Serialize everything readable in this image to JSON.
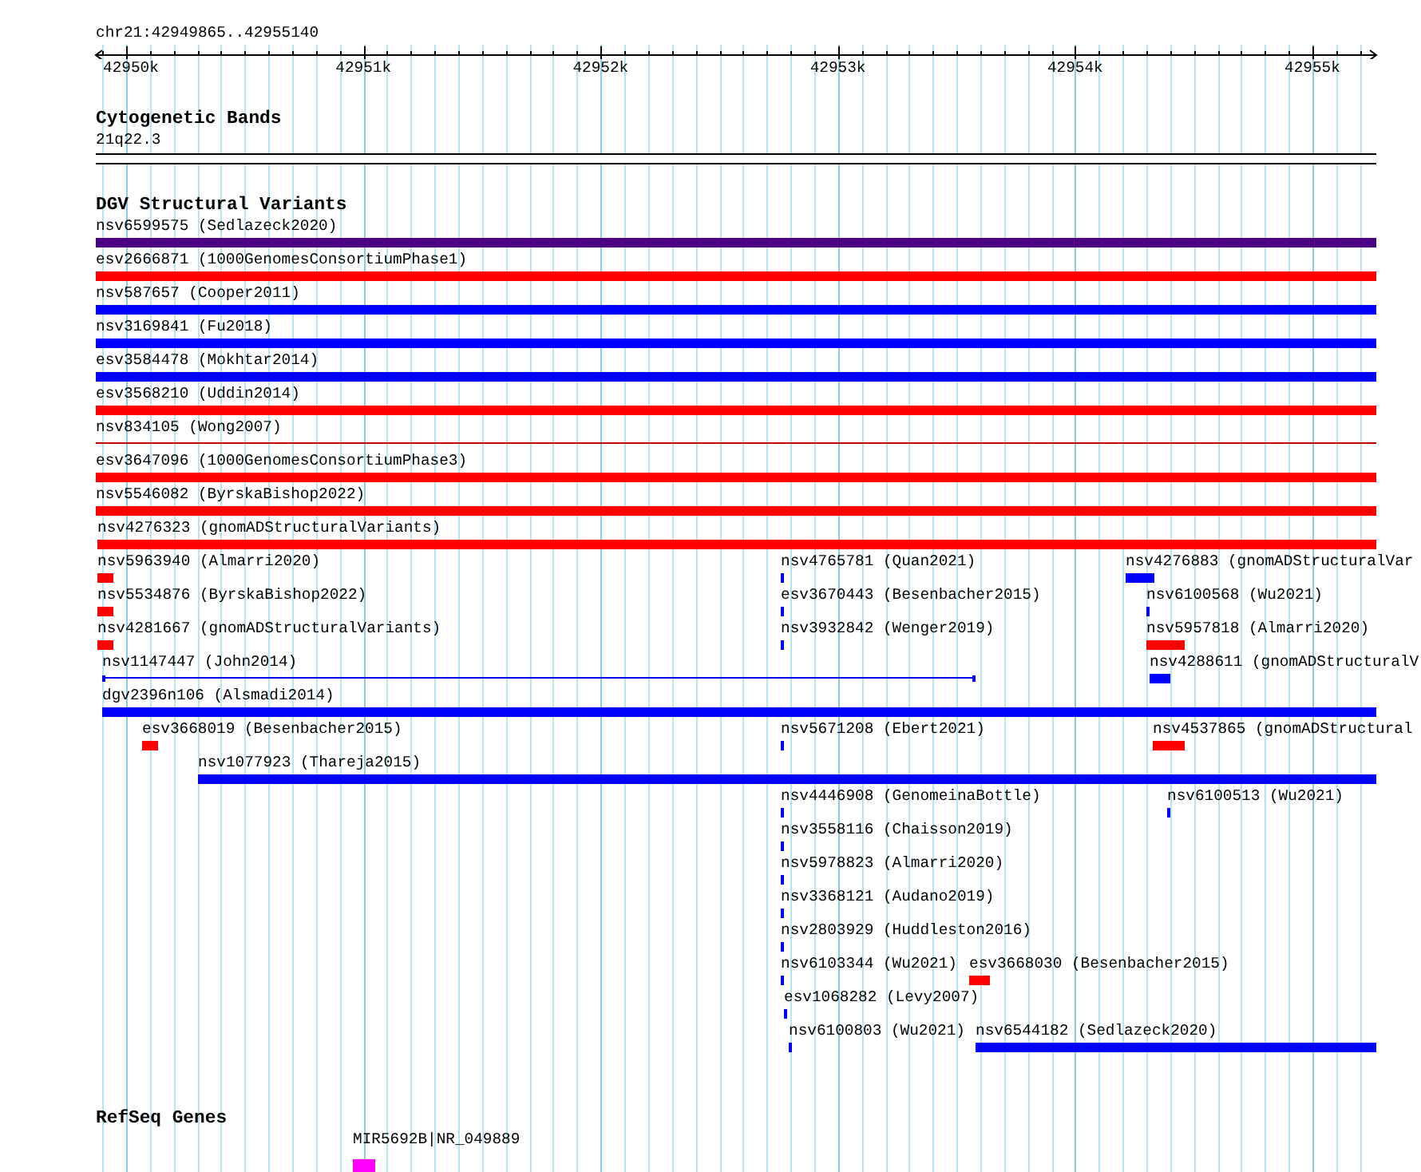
{
  "ruler": {
    "location": "chr21:42949865..42955140",
    "ticks": [
      {
        "label": "42950k"
      },
      {
        "label": "42951k"
      },
      {
        "label": "42952k"
      },
      {
        "label": "42953k"
      },
      {
        "label": "42954k"
      },
      {
        "label": "42955k"
      }
    ]
  },
  "tracks": [
    {
      "kind": "cytoband",
      "title": "Cytogenetic Bands",
      "bands": [
        {
          "name": "21q22.3"
        }
      ]
    },
    {
      "kind": "features",
      "title": "DGV Structural Variants",
      "lanes": [
        {
          "features": [
            {
              "kind": "bar",
              "label": "nsv6599575 (Sedlazeck2020)",
              "color": "#4b0082"
            }
          ]
        },
        {
          "features": [
            {
              "kind": "bar",
              "label": "esv2666871 (1000GenomesConsortiumPhase1)",
              "color": "#ff0000"
            }
          ]
        },
        {
          "features": [
            {
              "kind": "bar",
              "label": "nsv587657 (Cooper2011)",
              "color": "#0000ff"
            }
          ]
        },
        {
          "features": [
            {
              "kind": "bar",
              "label": "nsv3169841 (Fu2018)",
              "color": "#0000ff"
            }
          ]
        },
        {
          "features": [
            {
              "kind": "bar",
              "label": "esv3584478 (Mokhtar2014)",
              "color": "#0000ff"
            }
          ]
        },
        {
          "features": [
            {
              "kind": "bar",
              "label": "esv3568210 (Uddin2014)",
              "color": "#ff0000"
            }
          ]
        },
        {
          "features": [
            {
              "kind": "line",
              "label": "nsv834105 (Wong2007)",
              "color": "#c00000"
            }
          ]
        },
        {
          "features": [
            {
              "kind": "bar",
              "label": "esv3647096 (1000GenomesConsortiumPhase3)",
              "color": "#ff0000"
            }
          ]
        },
        {
          "features": [
            {
              "kind": "bar",
              "label": "nsv5546082 (ByrskaBishop2022)",
              "color": "#ff0000"
            }
          ]
        },
        {
          "features": [
            {
              "kind": "bar",
              "label": "nsv4276323 (gnomADStructuralVariants)",
              "color": "#ff0000"
            }
          ]
        },
        {
          "features": [
            {
              "kind": "bar",
              "label": "nsv5963940 (Almarri2020)",
              "color": "#ff0000"
            },
            {
              "kind": "bar",
              "label": "nsv4765781 (Quan2021)",
              "color": "#0000ff"
            },
            {
              "kind": "bar",
              "label": "nsv4276883 (gnomADStructuralVar",
              "color": "#0000ff"
            }
          ]
        },
        {
          "features": [
            {
              "kind": "bar",
              "label": "nsv5534876 (ByrskaBishop2022)",
              "color": "#ff0000"
            },
            {
              "kind": "bar",
              "label": "esv3670443 (Besenbacher2015)",
              "color": "#0000ff"
            },
            {
              "kind": "bar",
              "label": "nsv6100568 (Wu2021)",
              "color": "#0000ff"
            }
          ]
        },
        {
          "features": [
            {
              "kind": "bar",
              "label": "nsv4281667 (gnomADStructuralVariants)",
              "color": "#ff0000"
            },
            {
              "kind": "bar",
              "label": "nsv3932842 (Wenger2019)",
              "color": "#0000ff"
            },
            {
              "kind": "bar",
              "label": "nsv5957818 (Almarri2020)",
              "color": "#ff0000"
            }
          ]
        },
        {
          "features": [
            {
              "kind": "line",
              "label": "nsv1147447 (John2014)",
              "color": "#0000ff"
            },
            {
              "kind": "bar",
              "label": "nsv4288611 (gnomADStructuralV",
              "color": "#0000ff"
            }
          ]
        },
        {
          "features": [
            {
              "kind": "bar",
              "label": "dgv2396n106 (Alsmadi2014)",
              "color": "#0000ff"
            }
          ]
        },
        {
          "features": [
            {
              "kind": "bar",
              "label": "esv3668019 (Besenbacher2015)",
              "color": "#ff0000"
            },
            {
              "kind": "bar",
              "label": "nsv5671208 (Ebert2021)",
              "color": "#0000ff"
            },
            {
              "kind": "bar",
              "label": "nsv4537865 (gnomADStructural",
              "color": "#ff0000"
            }
          ]
        },
        {
          "features": [
            {
              "kind": "bar",
              "label": "nsv1077923 (Thareja2015)",
              "color": "#0000ff"
            }
          ]
        },
        {
          "features": [
            {
              "kind": "bar",
              "label": "nsv4446908 (GenomeinaBottle)",
              "color": "#0000ff"
            },
            {
              "kind": "bar",
              "label": "nsv6100513 (Wu2021)",
              "color": "#0000ff"
            }
          ]
        },
        {
          "features": [
            {
              "kind": "bar",
              "label": "nsv3558116 (Chaisson2019)",
              "color": "#0000ff"
            }
          ]
        },
        {
          "features": [
            {
              "kind": "bar",
              "label": "nsv5978823 (Almarri2020)",
              "color": "#0000ff"
            }
          ]
        },
        {
          "features": [
            {
              "kind": "bar",
              "label": "nsv3368121 (Audano2019)",
              "color": "#0000ff"
            }
          ]
        },
        {
          "features": [
            {
              "kind": "bar",
              "label": "nsv2803929 (Huddleston2016)",
              "color": "#0000ff"
            }
          ]
        },
        {
          "features": [
            {
              "kind": "bar",
              "label": "nsv6103344 (Wu2021)",
              "color": "#0000ff"
            },
            {
              "kind": "bar",
              "label": "esv3668030 (Besenbacher2015)",
              "color": "#ff0000"
            }
          ]
        },
        {
          "features": [
            {
              "kind": "bar",
              "label": "esv1068282 (Levy2007)",
              "color": "#0000ff"
            }
          ]
        },
        {
          "features": [
            {
              "kind": "bar",
              "label": "nsv6100803 (Wu2021)",
              "color": "#0000ff"
            },
            {
              "kind": "bar",
              "label": "nsv6544182 (Sedlazeck2020)",
              "color": "#0000ff"
            }
          ]
        }
      ]
    },
    {
      "kind": "genes",
      "title": "RefSeq Genes",
      "lanes": [
        {
          "features": [
            {
              "kind": "gene",
              "label": "MIR5692B|NR_049889",
              "color": "#ff00ff"
            }
          ]
        }
      ]
    }
  ]
}
